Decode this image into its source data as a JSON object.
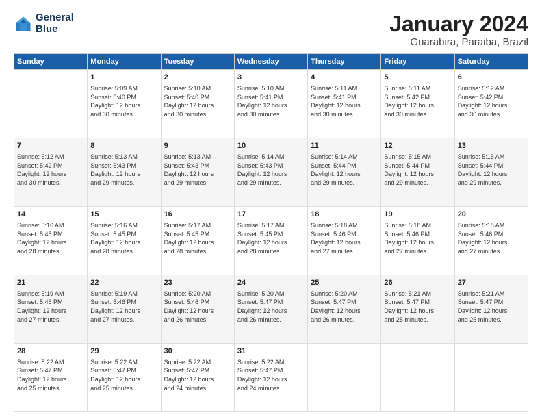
{
  "header": {
    "logo_line1": "General",
    "logo_line2": "Blue",
    "title": "January 2024",
    "subtitle": "Guarabira, Paraiba, Brazil"
  },
  "columns": [
    "Sunday",
    "Monday",
    "Tuesday",
    "Wednesday",
    "Thursday",
    "Friday",
    "Saturday"
  ],
  "weeks": [
    [
      {
        "day": "",
        "info": ""
      },
      {
        "day": "1",
        "info": "Sunrise: 5:09 AM\nSunset: 5:40 PM\nDaylight: 12 hours\nand 30 minutes."
      },
      {
        "day": "2",
        "info": "Sunrise: 5:10 AM\nSunset: 5:40 PM\nDaylight: 12 hours\nand 30 minutes."
      },
      {
        "day": "3",
        "info": "Sunrise: 5:10 AM\nSunset: 5:41 PM\nDaylight: 12 hours\nand 30 minutes."
      },
      {
        "day": "4",
        "info": "Sunrise: 5:11 AM\nSunset: 5:41 PM\nDaylight: 12 hours\nand 30 minutes."
      },
      {
        "day": "5",
        "info": "Sunrise: 5:11 AM\nSunset: 5:42 PM\nDaylight: 12 hours\nand 30 minutes."
      },
      {
        "day": "6",
        "info": "Sunrise: 5:12 AM\nSunset: 5:42 PM\nDaylight: 12 hours\nand 30 minutes."
      }
    ],
    [
      {
        "day": "7",
        "info": "Sunrise: 5:12 AM\nSunset: 5:42 PM\nDaylight: 12 hours\nand 30 minutes."
      },
      {
        "day": "8",
        "info": "Sunrise: 5:13 AM\nSunset: 5:43 PM\nDaylight: 12 hours\nand 29 minutes."
      },
      {
        "day": "9",
        "info": "Sunrise: 5:13 AM\nSunset: 5:43 PM\nDaylight: 12 hours\nand 29 minutes."
      },
      {
        "day": "10",
        "info": "Sunrise: 5:14 AM\nSunset: 5:43 PM\nDaylight: 12 hours\nand 29 minutes."
      },
      {
        "day": "11",
        "info": "Sunrise: 5:14 AM\nSunset: 5:44 PM\nDaylight: 12 hours\nand 29 minutes."
      },
      {
        "day": "12",
        "info": "Sunrise: 5:15 AM\nSunset: 5:44 PM\nDaylight: 12 hours\nand 29 minutes."
      },
      {
        "day": "13",
        "info": "Sunrise: 5:15 AM\nSunset: 5:44 PM\nDaylight: 12 hours\nand 29 minutes."
      }
    ],
    [
      {
        "day": "14",
        "info": "Sunrise: 5:16 AM\nSunset: 5:45 PM\nDaylight: 12 hours\nand 28 minutes."
      },
      {
        "day": "15",
        "info": "Sunrise: 5:16 AM\nSunset: 5:45 PM\nDaylight: 12 hours\nand 28 minutes."
      },
      {
        "day": "16",
        "info": "Sunrise: 5:17 AM\nSunset: 5:45 PM\nDaylight: 12 hours\nand 28 minutes."
      },
      {
        "day": "17",
        "info": "Sunrise: 5:17 AM\nSunset: 5:45 PM\nDaylight: 12 hours\nand 28 minutes."
      },
      {
        "day": "18",
        "info": "Sunrise: 5:18 AM\nSunset: 5:46 PM\nDaylight: 12 hours\nand 27 minutes."
      },
      {
        "day": "19",
        "info": "Sunrise: 5:18 AM\nSunset: 5:46 PM\nDaylight: 12 hours\nand 27 minutes."
      },
      {
        "day": "20",
        "info": "Sunrise: 5:18 AM\nSunset: 5:46 PM\nDaylight: 12 hours\nand 27 minutes."
      }
    ],
    [
      {
        "day": "21",
        "info": "Sunrise: 5:19 AM\nSunset: 5:46 PM\nDaylight: 12 hours\nand 27 minutes."
      },
      {
        "day": "22",
        "info": "Sunrise: 5:19 AM\nSunset: 5:46 PM\nDaylight: 12 hours\nand 27 minutes."
      },
      {
        "day": "23",
        "info": "Sunrise: 5:20 AM\nSunset: 5:46 PM\nDaylight: 12 hours\nand 26 minutes."
      },
      {
        "day": "24",
        "info": "Sunrise: 5:20 AM\nSunset: 5:47 PM\nDaylight: 12 hours\nand 26 minutes."
      },
      {
        "day": "25",
        "info": "Sunrise: 5:20 AM\nSunset: 5:47 PM\nDaylight: 12 hours\nand 26 minutes."
      },
      {
        "day": "26",
        "info": "Sunrise: 5:21 AM\nSunset: 5:47 PM\nDaylight: 12 hours\nand 25 minutes."
      },
      {
        "day": "27",
        "info": "Sunrise: 5:21 AM\nSunset: 5:47 PM\nDaylight: 12 hours\nand 25 minutes."
      }
    ],
    [
      {
        "day": "28",
        "info": "Sunrise: 5:22 AM\nSunset: 5:47 PM\nDaylight: 12 hours\nand 25 minutes."
      },
      {
        "day": "29",
        "info": "Sunrise: 5:22 AM\nSunset: 5:47 PM\nDaylight: 12 hours\nand 25 minutes."
      },
      {
        "day": "30",
        "info": "Sunrise: 5:22 AM\nSunset: 5:47 PM\nDaylight: 12 hours\nand 24 minutes."
      },
      {
        "day": "31",
        "info": "Sunrise: 5:22 AM\nSunset: 5:47 PM\nDaylight: 12 hours\nand 24 minutes."
      },
      {
        "day": "",
        "info": ""
      },
      {
        "day": "",
        "info": ""
      },
      {
        "day": "",
        "info": ""
      }
    ]
  ]
}
